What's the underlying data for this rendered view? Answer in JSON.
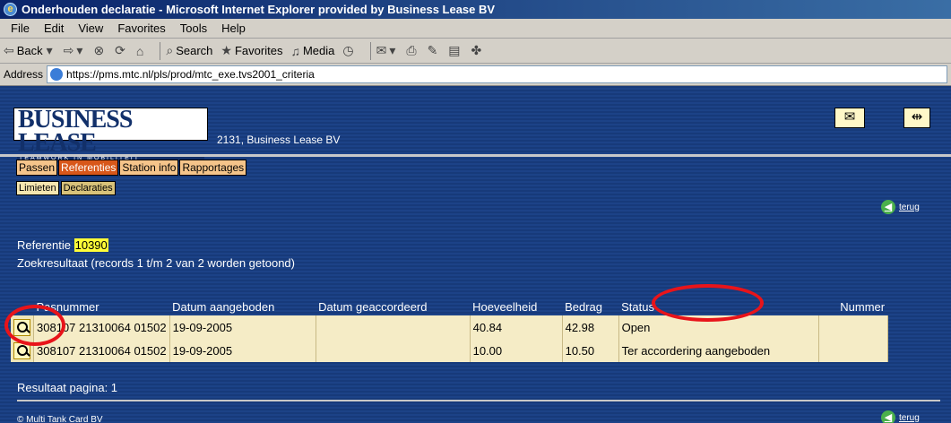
{
  "window": {
    "title": "Onderhouden declaratie - Microsoft Internet Explorer provided by Business Lease BV"
  },
  "menu": [
    "File",
    "Edit",
    "View",
    "Favorites",
    "Tools",
    "Help"
  ],
  "toolbar": {
    "back": "Back",
    "search": "Search",
    "favorites": "Favorites",
    "media": "Media"
  },
  "address": {
    "label": "Address",
    "url": "https://pms.mtc.nl/pls/prod/mtc_exe.tvs2001_criteria"
  },
  "header": {
    "logo_main": "BUSINESS LEASE",
    "logo_tag": "TEAMWORK IN MOBILITEIT",
    "company": "2131, Business Lease BV"
  },
  "tabs": [
    {
      "label": "Passen",
      "active": false
    },
    {
      "label": "Referenties",
      "active": true
    },
    {
      "label": "Station info",
      "active": false
    },
    {
      "label": "Rapportages",
      "active": false
    }
  ],
  "subtabs": [
    {
      "label": "Limieten",
      "active": false
    },
    {
      "label": "Declaraties",
      "active": true
    }
  ],
  "back_link": "terug",
  "reference": {
    "label": "Referentie",
    "value": "10390"
  },
  "search_result": "Zoekresultaat (records 1 t/m 2 van 2 worden getoond)",
  "table": {
    "columns": [
      "Pasnummer",
      "Datum aangeboden",
      "Datum geaccordeerd",
      "Hoeveelheid",
      "Bedrag",
      "Status",
      "Nummer"
    ],
    "rows": [
      [
        "308107 21310064 01502",
        "19-09-2005",
        "",
        "40.84",
        "42.98",
        "Open",
        ""
      ],
      [
        "308107 21310064 01502",
        "19-09-2005",
        "",
        "10.00",
        "10.50",
        "Ter accordering aangeboden",
        ""
      ]
    ]
  },
  "result_page": "Resultaat pagina: 1",
  "copyright": "© Multi Tank Card BV",
  "colors": {
    "page_bg": "#1c4287",
    "tab": "#f5c48a",
    "tab_active": "#d8571a",
    "reference_highlight": "#fffd38",
    "row_bg": "#f5ecc6",
    "annotation_circle": "#e8141a"
  }
}
